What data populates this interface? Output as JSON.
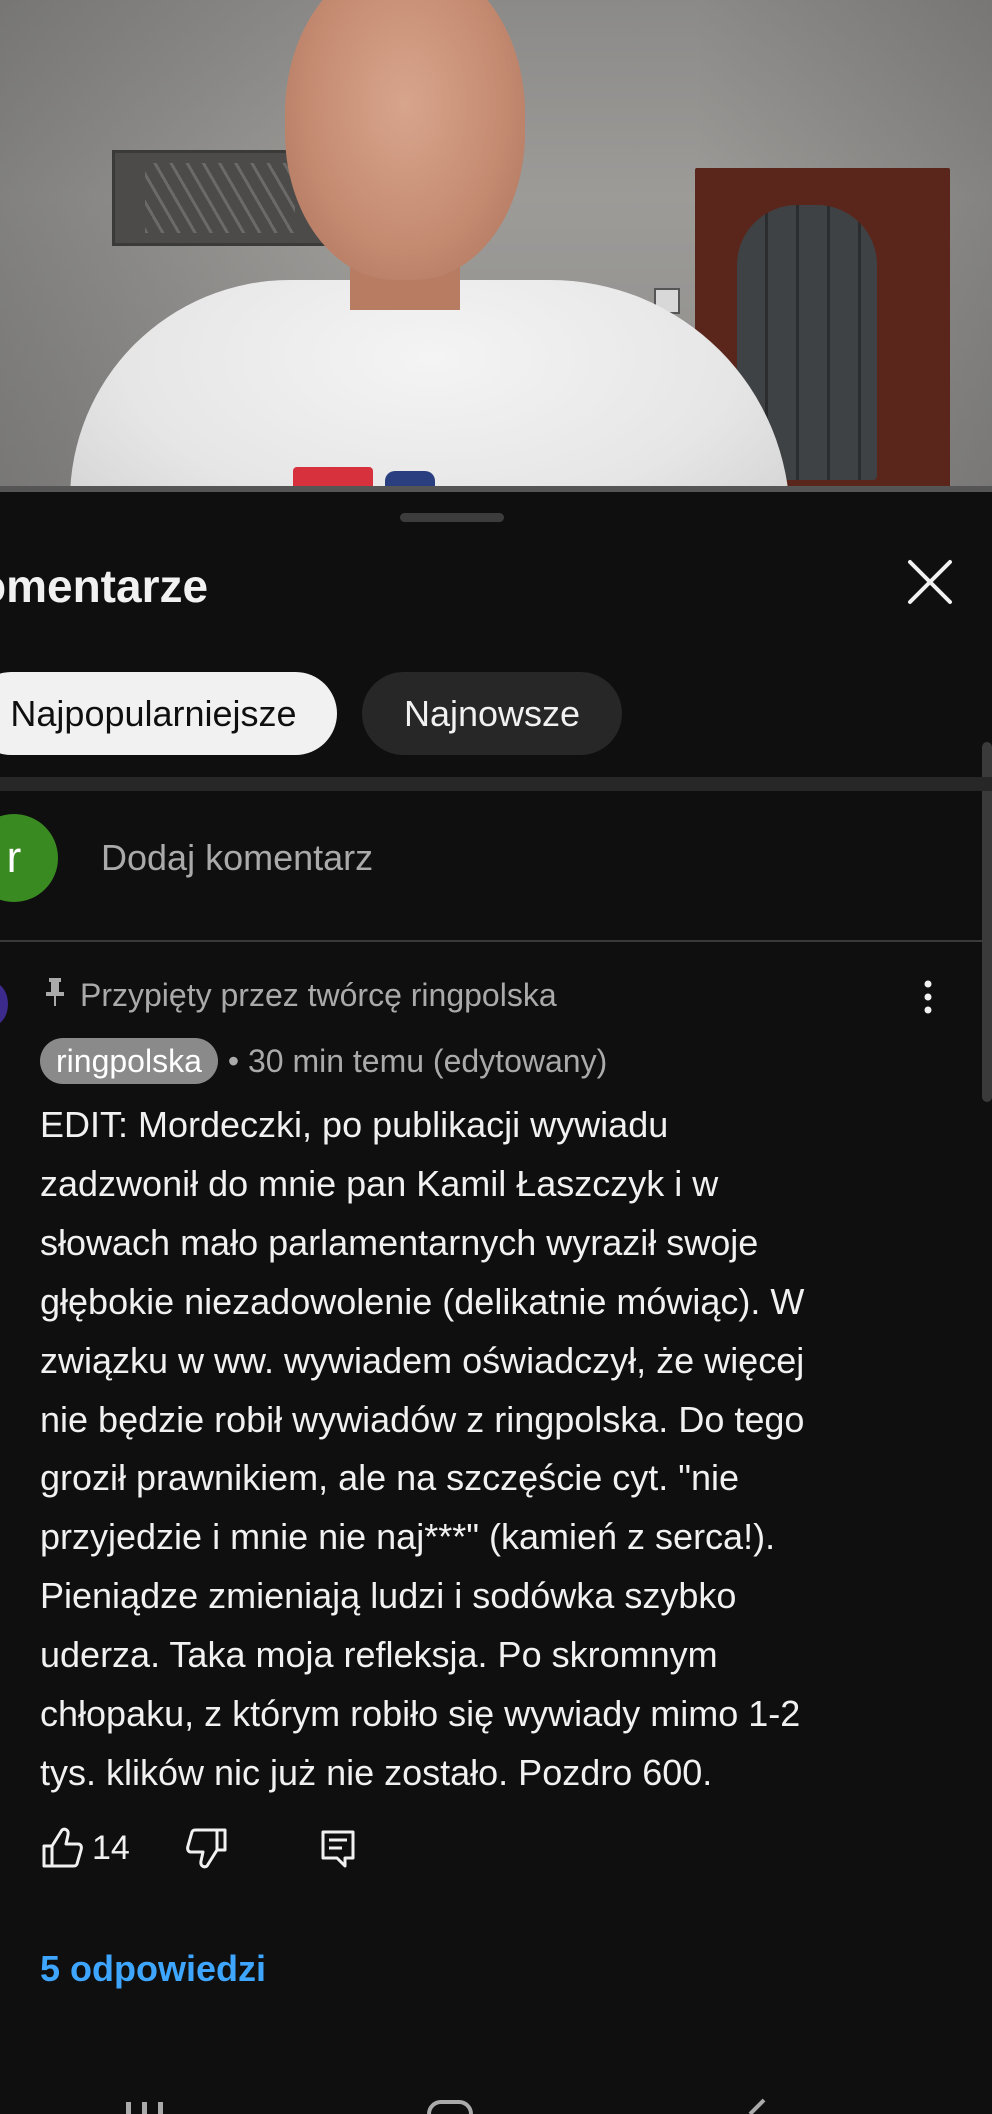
{
  "sheet": {
    "title": "omentarze",
    "close_icon": "close-icon"
  },
  "sort_chips": [
    {
      "label": "Najpopularniejsze",
      "selected": true
    },
    {
      "label": "Najnowsze",
      "selected": false
    }
  ],
  "add_comment": {
    "avatar_initial": "r",
    "avatar_color": "#3a8a22",
    "placeholder": "Dodaj komentarz"
  },
  "pinned_comment": {
    "pinned_label": "Przypięty przez twórcę ringpolska",
    "author": "ringpolska",
    "meta": "• 30 min temu (edytowany)",
    "body_lines": [
      "EDIT: Mordeczki, po publikacji wywiadu",
      "zadzwonił do mnie pan Kamil Łaszczyk i w",
      "słowach mało parlamentarnych wyraził swoje",
      "głębokie niezadowolenie (delikatnie mówiąc). W",
      "związku w ww. wywiadem oświadczył, że więcej",
      "nie będzie robił wywiadów z ringpolska. Do tego",
      "groził prawnikiem, ale na szczęście cyt. \"nie",
      "przyjedzie i mnie nie naj***\" (kamień z serca!).",
      "Pieniądze zmieniają ludzi i sodówka szybko",
      "uderza. Taka moja refleksja. Po skromnym",
      "chłopaku, z którym robiło się wywiady mimo 1-2",
      "tys. klików nic już nie zostało. Pozdro 600."
    ],
    "likes": "14",
    "replies_link": "5 odpowiedzi"
  },
  "colors": {
    "background": "#0f0f0f",
    "link": "#3ea6ff",
    "secondary_text": "#aaaaaa"
  }
}
